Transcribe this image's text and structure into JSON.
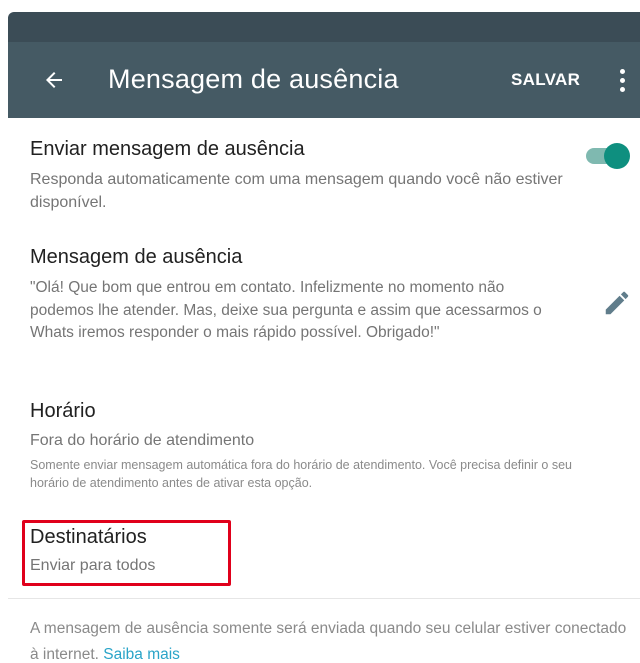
{
  "app_bar": {
    "title": "Mensagem de ausência",
    "save_label": "SALVAR",
    "back_icon": "arrow-back-icon",
    "more_icon": "more-vert-icon"
  },
  "settings": {
    "away_toggle": {
      "title": "Enviar mensagem de ausência",
      "subtitle": "Responda automaticamente com uma mensagem quando você não estiver disponível.",
      "enabled": true
    },
    "away_message": {
      "title": "Mensagem de ausência",
      "text": "\"Olá! Que bom que entrou em contato. Infelizmente no momento não podemos lhe atender. Mas, deixe sua pergunta e assim que acessarmos o Whats iremos responder o mais rápido possível. Obrigado!\"",
      "edit_icon": "pencil-icon"
    },
    "schedule": {
      "title": "Horário",
      "value": "Fora do horário de atendimento",
      "note": "Somente enviar mensagem automática fora do horário de atendimento. Você precisa definir o seu horário de atendimento antes de ativar esta opção."
    },
    "recipients": {
      "title": "Destinatários",
      "value": "Enviar para todos"
    }
  },
  "footer": {
    "note": "A mensagem de ausência somente será enviada quando seu celular estiver conectado à internet.",
    "link": "Saiba mais"
  },
  "colors": {
    "app_bar": "#455a64",
    "status_bar": "#3b4c56",
    "toggle_on": "#0e8f7f",
    "highlight": "#e0001b",
    "link": "#2aa4c8"
  }
}
